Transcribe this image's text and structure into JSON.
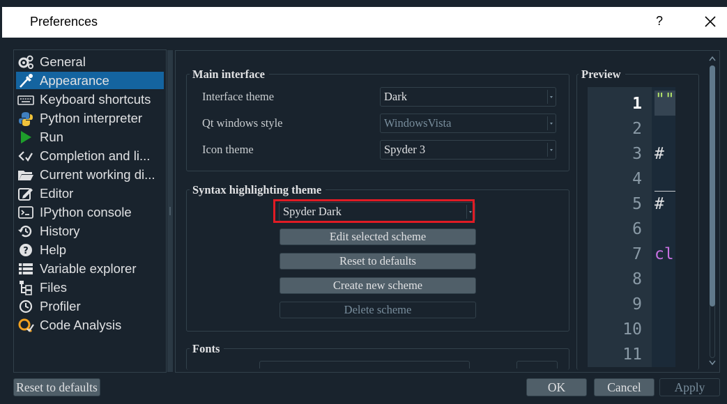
{
  "window": {
    "title": "Preferences",
    "help_label": "?"
  },
  "sidebar": {
    "items": [
      {
        "label": "General",
        "icon": "gears-icon"
      },
      {
        "label": "Appearance",
        "icon": "eyedropper-icon",
        "selected": true
      },
      {
        "label": "Keyboard shortcuts",
        "icon": "keyboard-icon"
      },
      {
        "label": "Python interpreter",
        "icon": "python-icon"
      },
      {
        "label": "Run",
        "icon": "play-icon"
      },
      {
        "label": "Completion and li...",
        "icon": "completion-icon"
      },
      {
        "label": "Current working di...",
        "icon": "folder-open-icon"
      },
      {
        "label": "Editor",
        "icon": "edit-icon"
      },
      {
        "label": "IPython console",
        "icon": "terminal-icon"
      },
      {
        "label": "History",
        "icon": "history-icon"
      },
      {
        "label": "Help",
        "icon": "question-circle-icon"
      },
      {
        "label": "Variable explorer",
        "icon": "table-icon"
      },
      {
        "label": "Files",
        "icon": "file-tree-icon"
      },
      {
        "label": "Profiler",
        "icon": "clock-icon"
      },
      {
        "label": "Code Analysis",
        "icon": "code-analysis-icon"
      }
    ]
  },
  "main_interface": {
    "title": "Main interface",
    "interface_theme_label": "Interface theme",
    "interface_theme_value": "Dark",
    "qt_style_label": "Qt windows style",
    "qt_style_value": "WindowsVista",
    "icon_theme_label": "Icon theme",
    "icon_theme_value": "Spyder 3"
  },
  "syntax": {
    "title": "Syntax highlighting theme",
    "scheme_value": "Spyder Dark",
    "edit_label": "Edit selected scheme",
    "reset_label": "Reset to defaults",
    "create_label": "Create new scheme",
    "delete_label": "Delete scheme"
  },
  "fonts": {
    "title": "Fonts"
  },
  "preview": {
    "title": "Preview",
    "line_numbers": [
      "1",
      "2",
      "3",
      "4",
      "5",
      "6",
      "7",
      "8",
      "9",
      "10",
      "11"
    ],
    "code_fragments": [
      "\"\"",
      "#",
      "#",
      "cl"
    ]
  },
  "footer": {
    "reset_label": "Reset to defaults",
    "ok_label": "OK",
    "cancel_label": "Cancel",
    "apply_label": "Apply"
  },
  "colors": {
    "background": "#19232d",
    "selection": "#1464a0",
    "highlight_border": "#e01b24",
    "string": "#b2e26a",
    "comment": "#e0e1e3",
    "keyword": "#c670e0"
  }
}
